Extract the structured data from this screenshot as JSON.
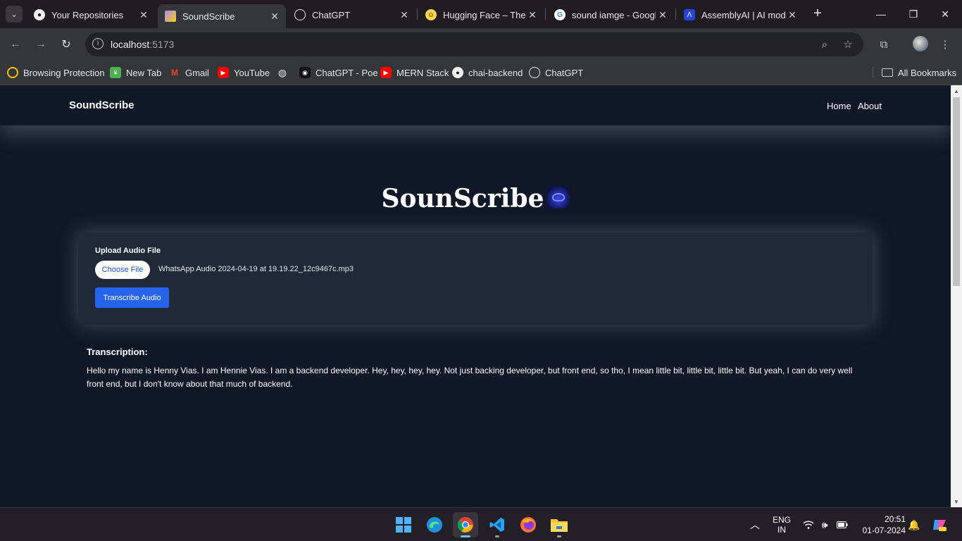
{
  "browser": {
    "tab_search_icon": "chevron-down-icon",
    "tabs": [
      {
        "label": "Your Repositories",
        "icon": "github-icon",
        "active": false
      },
      {
        "label": "SoundScribe",
        "icon": "vite-icon",
        "active": true
      },
      {
        "label": "ChatGPT",
        "icon": "openai-icon",
        "active": false
      },
      {
        "label": "Hugging Face – The A",
        "icon": "hugging-face-icon",
        "active": false
      },
      {
        "label": "sound iamge - Googl",
        "icon": "google-icon",
        "active": false
      },
      {
        "label": "AssemblyAI | AI mode",
        "icon": "assemblyai-icon",
        "active": false
      }
    ],
    "tab_close_glyph": "✕",
    "new_tab_glyph": "+",
    "url_host": "localhost",
    "url_port": ":5173",
    "bookmarks": [
      {
        "label": "Browsing Protection",
        "icon": "shield-icon"
      },
      {
        "label": "New Tab",
        "icon": "new-tab-icon"
      },
      {
        "label": "Gmail",
        "icon": "gmail-icon"
      },
      {
        "label": "YouTube",
        "icon": "youtube-icon"
      },
      {
        "label": "",
        "icon": "globe-icon"
      },
      {
        "label": "ChatGPT - Poe",
        "icon": "poe-icon"
      },
      {
        "label": "MERN Stack",
        "icon": "youtube-icon"
      },
      {
        "label": "chai-backend",
        "icon": "github-icon"
      },
      {
        "label": "ChatGPT",
        "icon": "openai-icon"
      }
    ],
    "all_bookmarks": "All Bookmarks"
  },
  "page": {
    "brand": "SoundScribe",
    "nav": [
      "Home",
      "About"
    ],
    "hero_title": "SounScribe",
    "upload_label": "Upload Audio File",
    "choose_file_label": "Choose File",
    "file_name": "WhatsApp Audio 2024-04-19 at 19.19.22_12c9467c.mp3",
    "transcribe_button": "Transcribe Audio",
    "transcription_title": "Transcription:",
    "transcription_text": "Hello my name is Henny Vias. I am Hennie Vias. I am a backend developer. Hey, hey, hey, hey. Not just backing developer, but front end, so tho, I mean little bit, little bit, little bit. But yeah, I can do very well front end, but I don't know about that much of backend."
  },
  "taskbar": {
    "apps": [
      "windows-start-icon",
      "edge-icon",
      "chrome-icon",
      "vscode-icon",
      "firefox-icon",
      "file-explorer-icon"
    ],
    "lang_top": "ENG",
    "lang_bottom": "IN",
    "time": "20:51",
    "date": "01-07-2024"
  },
  "colors": {
    "page_bg": "#111827",
    "card_bg": "#1f2937",
    "primary": "#2563eb",
    "text": "#ffffff"
  }
}
